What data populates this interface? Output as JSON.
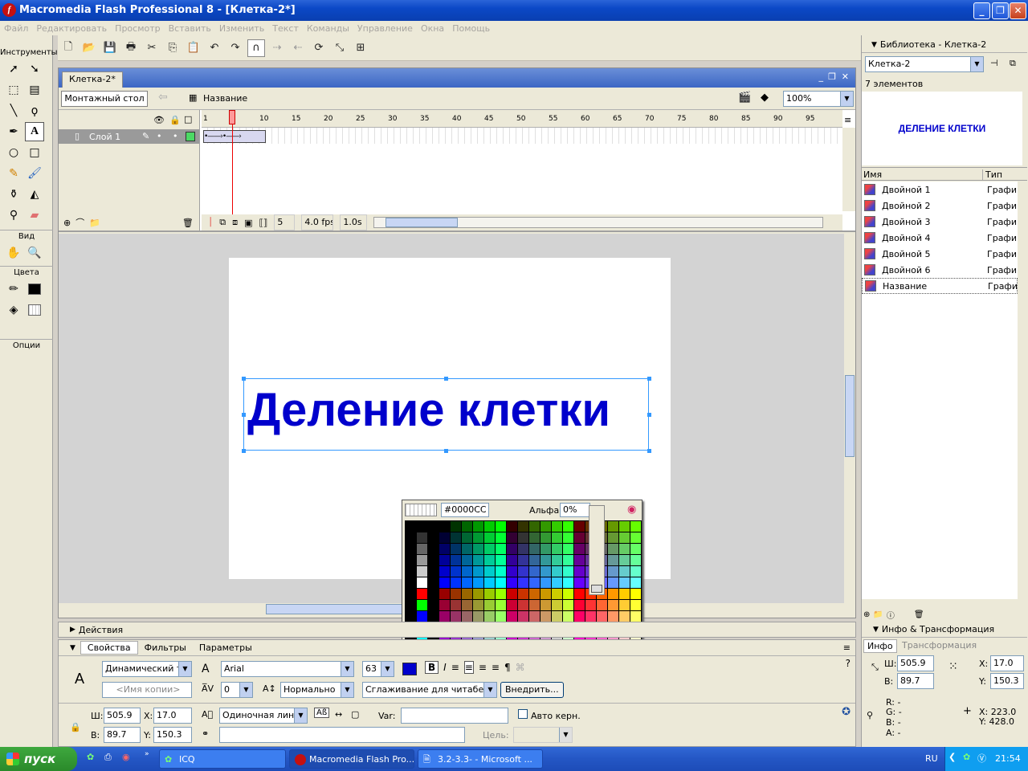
{
  "window": {
    "title": "Macromedia Flash Professional 8 - [Клетка-2*]"
  },
  "menu": [
    "Файл",
    "Редактировать",
    "Просмотр",
    "Вставить",
    "Изменить",
    "Текст",
    "Команды",
    "Управление",
    "Окна",
    "Помощь"
  ],
  "tools": {
    "header": "Инструменты",
    "view_label": "Вид",
    "colors_label": "Цвета",
    "options_label": "Опции"
  },
  "document": {
    "tab": "Клетка-2*",
    "scene_button": "Монтажный стол",
    "symbol_name": "Название",
    "zoom": "100%"
  },
  "timeline": {
    "layer_name": "Слой 1",
    "ticks": [
      "1",
      "5",
      "10",
      "15",
      "20",
      "25",
      "30",
      "35",
      "40",
      "45",
      "50",
      "55",
      "60",
      "65",
      "70",
      "75",
      "80",
      "85",
      "90",
      "95"
    ],
    "current_frame": "5",
    "fps": "4.0 fps",
    "time": "1.0s"
  },
  "stage": {
    "text": "Деление клетки"
  },
  "palette": {
    "hex": "#0000CC",
    "alpha_label": "Альфа:",
    "alpha_value": "0%"
  },
  "panels": {
    "actions": "Действия",
    "tabs": [
      "Свойства",
      "Фильтры",
      "Параметры"
    ]
  },
  "properties": {
    "text_type": "Динамический те",
    "instance_name": "<Имя копии>",
    "font": "Arial",
    "size": "63",
    "tracking": "0",
    "position": "Нормально",
    "antialias": "Сглаживание для читабельн",
    "embed": "Внедрить...",
    "w_label": "Ш:",
    "w": "505.9",
    "h_label": "В:",
    "h": "89.7",
    "x_label": "X:",
    "x": "17.0",
    "y_label": "Y:",
    "y": "150.3",
    "line_type": "Одиночная линия",
    "var_label": "Var:",
    "auto_kern": "Авто керн.",
    "target_label": "Цель:"
  },
  "library": {
    "title": "Библиотека - Клетка-2",
    "doc": "Клетка-2",
    "count": "7 элементов",
    "preview": "ДЕЛЕНИЕ КЛЕТКИ",
    "col_name": "Имя",
    "col_type": "Тип",
    "items": [
      {
        "name": "Двойной 1",
        "type": "Графи"
      },
      {
        "name": "Двойной 2",
        "type": "Графи"
      },
      {
        "name": "Двойной 3",
        "type": "Графи"
      },
      {
        "name": "Двойной 4",
        "type": "Графи"
      },
      {
        "name": "Двойной 5",
        "type": "Графи"
      },
      {
        "name": "Двойной 6",
        "type": "Графи"
      },
      {
        "name": "Название",
        "type": "Графи"
      }
    ]
  },
  "info": {
    "title": "Инфо & Трансформация",
    "tab_info": "Инфо",
    "tab_transform": "Трансформация",
    "w": "505.9",
    "h": "89.7",
    "x": "17.0",
    "y": "150.3",
    "r": "R: -",
    "g": "G: -",
    "b": "B: -",
    "a": "A: -",
    "cx": "X: 223.0",
    "cy": "Y: 428.0",
    "w_label": "Ш:",
    "h_label": "В:",
    "x_label": "X:",
    "y_label": "Y:"
  },
  "taskbar": {
    "start": "пуск",
    "tasks": [
      "ICQ",
      "Macromedia Flash Pro...",
      "3.2-3.3- - Microsoft ..."
    ],
    "lang": "RU",
    "clock": "21:54"
  }
}
